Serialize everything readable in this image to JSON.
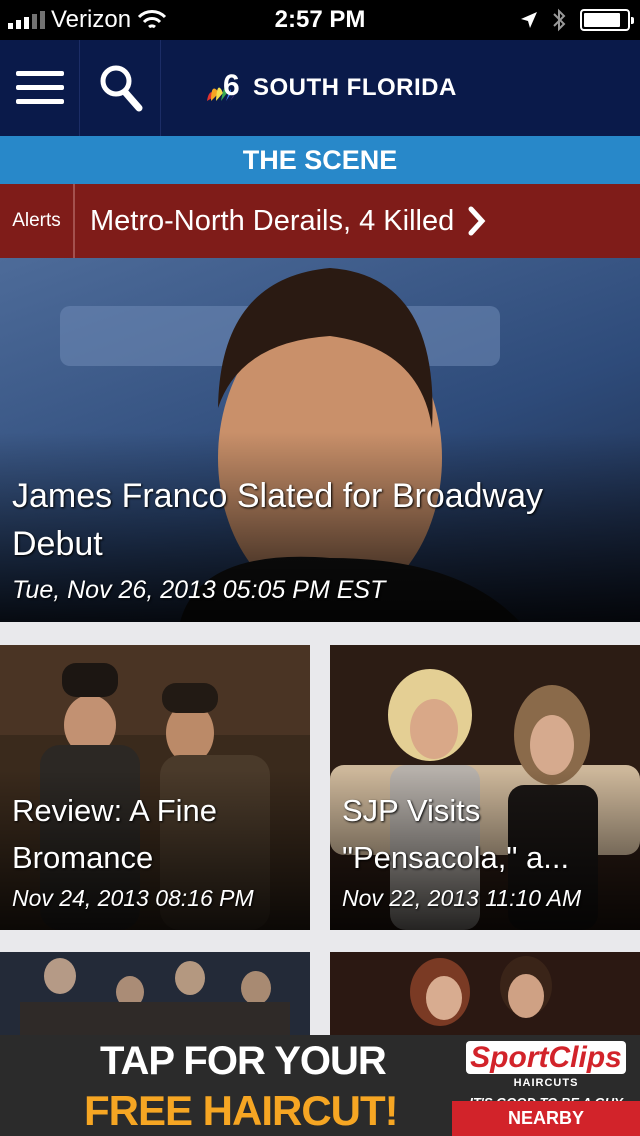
{
  "status_bar": {
    "carrier": "Verizon",
    "time": "2:57 PM",
    "battery_level": 0.85
  },
  "header": {
    "brand": "SOUTH FLORIDA",
    "brand_number": "6",
    "menu_icon": "hamburger-menu-icon",
    "search_icon": "search-icon"
  },
  "section": {
    "title": "THE SCENE"
  },
  "alerts": {
    "label": "Alerts",
    "headline": "Metro-North Derails, 4 Killed"
  },
  "hero": {
    "title": "James Franco Slated for Broadway Debut",
    "date": "Tue, Nov 26, 2013 05:05 PM EST"
  },
  "cards": [
    {
      "title": "Review: A Fine\nBromance",
      "date": "Nov 24, 2013 08:16 PM"
    },
    {
      "title": "SJP Visits\n\"Pensacola,\" a...",
      "date": "Nov 22, 2013 11:10 AM"
    }
  ],
  "ad": {
    "line1": "TAP FOR YOUR",
    "line2": "FREE HAIRCUT!",
    "brand": "SportClips",
    "brand_sub": "HAIRCUTS",
    "tagline": "IT'S GOOD TO BE A GUY",
    "cta": "NEARBY"
  },
  "colors": {
    "header_bg": "#0a1a4a",
    "section_bg": "#2888c9",
    "alert_bg": "#7f1c19",
    "ad_accent": "#f6a623",
    "ad_red": "#d2232a"
  }
}
